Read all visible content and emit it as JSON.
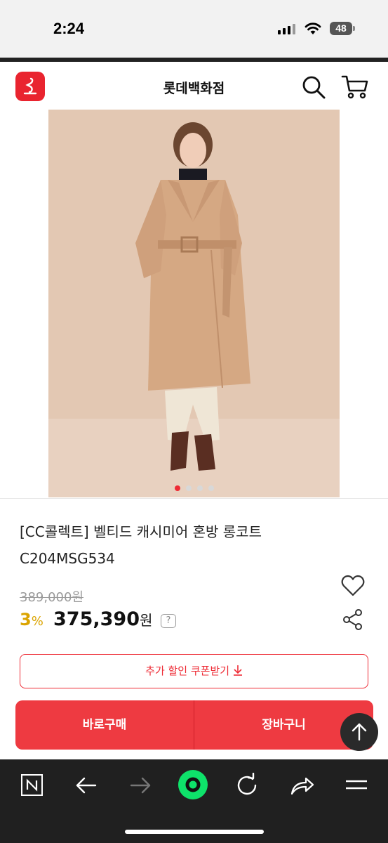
{
  "status_bar": {
    "time": "2:24",
    "battery": "48"
  },
  "header": {
    "title": "롯데백화점",
    "logo_icon": "lotte-logo-icon",
    "search_icon": "search-icon",
    "cart_icon": "cart-icon",
    "brand_color": "#e9242f"
  },
  "product": {
    "image_alt": "camel cashmere wrap coat model photo",
    "carousel_total": 4,
    "carousel_active": 1,
    "title": "[CC콜렉트] 벨티드 캐시미어 혼방 롱코트 C204MSG534",
    "original_price": "389,000원",
    "discount_rate": "3",
    "discount_unit": "%",
    "sale_price": "375,390",
    "sale_currency": "원",
    "help_label": "?",
    "discount_color": "#dba400"
  },
  "actions": {
    "coupon_label": "추가 할인 쿠폰받기",
    "buy_now_label": "바로구매",
    "add_cart_label": "장바구니",
    "accent_color": "#ee3a41"
  },
  "browser": {
    "buttons": [
      "naver-n-icon",
      "back-arrow-icon",
      "forward-arrow-icon",
      "green-dot-home-icon",
      "reload-icon",
      "share-icon",
      "menu-icon"
    ]
  }
}
